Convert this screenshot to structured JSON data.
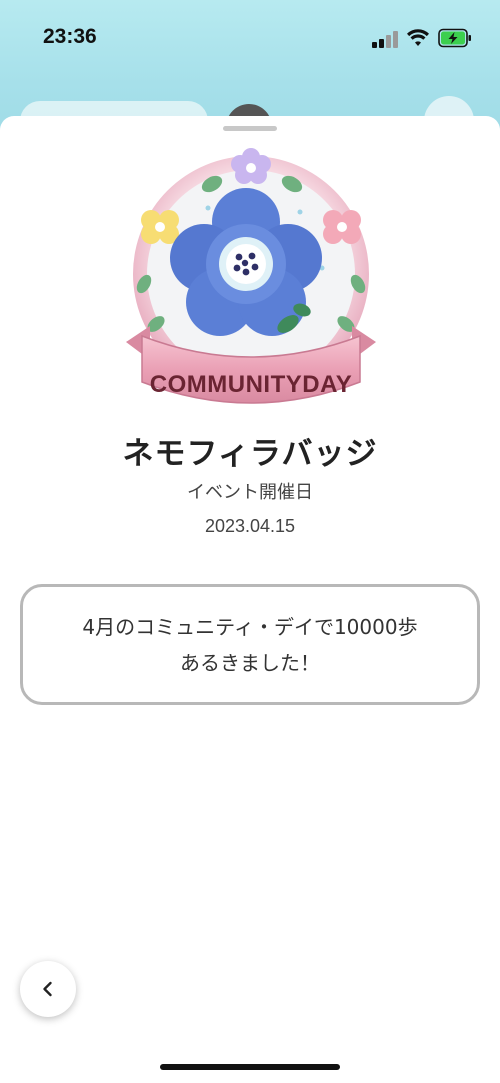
{
  "status_bar": {
    "time": "23:36"
  },
  "badge": {
    "banner_text": "COMMUNITYDAY",
    "image": "nemophila-flower-badge"
  },
  "detail": {
    "title": "ネモフィラバッジ",
    "subtitle": "イベント開催日",
    "date": "2023.04.15",
    "message_line1": "4月のコミュニティ・デイで10000歩",
    "message_line2": "あるきました！"
  },
  "icons": {
    "back": "chevron-left-icon",
    "settings": "gear-icon"
  },
  "colors": {
    "header_bg": "#a6e0ea",
    "badge_blue": "#5b7fd6",
    "banner_pink": "#e9a3b5",
    "battery_green": "#3ccf4e"
  }
}
